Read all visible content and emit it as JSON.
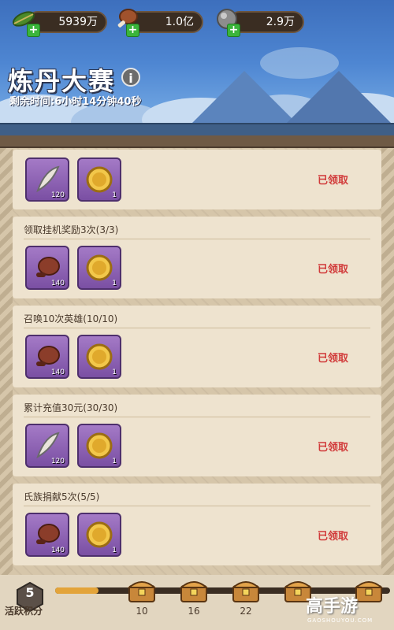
{
  "resources": [
    {
      "icon": "leaf-icon",
      "value": "5939万"
    },
    {
      "icon": "meat-icon",
      "value": "1.0亿"
    },
    {
      "icon": "stone-icon",
      "value": "2.9万"
    }
  ],
  "header": {
    "title": "炼丹大赛",
    "info_symbol": "i",
    "timer": "剩余时间:6小时14分钟40秒"
  },
  "tasks": [
    {
      "title": "",
      "rewards": [
        {
          "icon": "feather-icon",
          "qty": "120"
        },
        {
          "icon": "gold-coin-icon",
          "qty": "1"
        }
      ],
      "status": "已领取"
    },
    {
      "title": "领取挂机奖励3次(3/3)",
      "rewards": [
        {
          "icon": "meat-icon",
          "qty": "140"
        },
        {
          "icon": "gold-coin-icon",
          "qty": "1"
        }
      ],
      "status": "已领取"
    },
    {
      "title": "召唤10次英雄(10/10)",
      "rewards": [
        {
          "icon": "meat-icon",
          "qty": "140"
        },
        {
          "icon": "gold-coin-icon",
          "qty": "1"
        }
      ],
      "status": "已领取"
    },
    {
      "title": "累计充值30元(30/30)",
      "rewards": [
        {
          "icon": "feather-icon",
          "qty": "120"
        },
        {
          "icon": "gold-coin-icon",
          "qty": "1"
        }
      ],
      "status": "已领取"
    },
    {
      "title": "氏族捐献5次(5/5)",
      "rewards": [
        {
          "icon": "meat-icon",
          "qty": "140"
        },
        {
          "icon": "gold-coin-icon",
          "qty": "1"
        }
      ],
      "status": "已领取"
    }
  ],
  "activity": {
    "points": "5",
    "label": "活跃积分",
    "progress": 0.13,
    "milestones": [
      "10",
      "16",
      "22",
      "",
      ""
    ]
  },
  "watermark": {
    "text": "高手游",
    "sub": "GAOSHOUYOU.COM"
  },
  "colors": {
    "claimed": "#d13a3a",
    "item_bg": "#8f63b6",
    "progress": "#e3a43a"
  }
}
